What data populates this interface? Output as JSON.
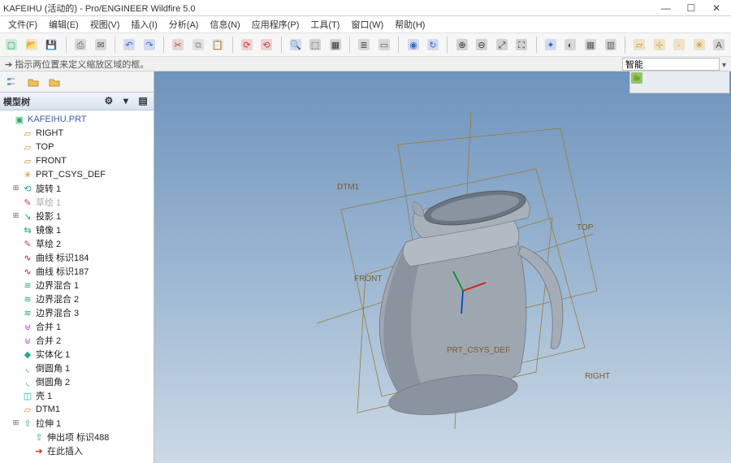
{
  "title": "KAFEIHU (活动的) - Pro/ENGINEER Wildfire 5.0",
  "menu": [
    "文件(F)",
    "编辑(E)",
    "视图(V)",
    "插入(I)",
    "分析(A)",
    "信息(N)",
    "应用程序(P)",
    "工具(T)",
    "窗口(W)",
    "帮助(H)"
  ],
  "statusMessage": "➔ 指示两位置来定义缩放区域的框。",
  "smartLabel": "智能",
  "treeHeader": "模型树",
  "tree": [
    {
      "lvl": 0,
      "exp": "",
      "icon": "part",
      "label": "KAFEIHU.PRT",
      "color": "#3a5ea8"
    },
    {
      "lvl": 1,
      "exp": "",
      "icon": "plane",
      "label": "RIGHT"
    },
    {
      "lvl": 1,
      "exp": "",
      "icon": "plane",
      "label": "TOP"
    },
    {
      "lvl": 1,
      "exp": "",
      "icon": "plane",
      "label": "FRONT"
    },
    {
      "lvl": 1,
      "exp": "",
      "icon": "csys",
      "label": "PRT_CSYS_DEF"
    },
    {
      "lvl": 1,
      "exp": "+",
      "icon": "revolve",
      "label": "旋转 1"
    },
    {
      "lvl": 1,
      "exp": "",
      "icon": "sketch",
      "label": "草绘 1",
      "dim": true
    },
    {
      "lvl": 1,
      "exp": "+",
      "icon": "project",
      "label": "投影 1"
    },
    {
      "lvl": 1,
      "exp": "",
      "icon": "mirror",
      "label": "镜像 1"
    },
    {
      "lvl": 1,
      "exp": "",
      "icon": "sketch",
      "label": "草绘 2"
    },
    {
      "lvl": 1,
      "exp": "",
      "icon": "curve",
      "label": "曲线 标识184"
    },
    {
      "lvl": 1,
      "exp": "",
      "icon": "curve",
      "label": "曲线 标识187"
    },
    {
      "lvl": 1,
      "exp": "",
      "icon": "blend",
      "label": "边界混合 1"
    },
    {
      "lvl": 1,
      "exp": "",
      "icon": "blend",
      "label": "边界混合 2"
    },
    {
      "lvl": 1,
      "exp": "",
      "icon": "blend",
      "label": "边界混合 3"
    },
    {
      "lvl": 1,
      "exp": "",
      "icon": "merge",
      "label": "合并 1"
    },
    {
      "lvl": 1,
      "exp": "",
      "icon": "merge",
      "label": "合并 2"
    },
    {
      "lvl": 1,
      "exp": "",
      "icon": "solidify",
      "label": "实体化 1"
    },
    {
      "lvl": 1,
      "exp": "",
      "icon": "round",
      "label": "倒圆角 1"
    },
    {
      "lvl": 1,
      "exp": "",
      "icon": "round",
      "label": "倒圆角 2"
    },
    {
      "lvl": 1,
      "exp": "",
      "icon": "shell",
      "label": "壳 1"
    },
    {
      "lvl": 1,
      "exp": "",
      "icon": "plane",
      "label": "DTM1"
    },
    {
      "lvl": 1,
      "exp": "+",
      "icon": "extrude",
      "label": "拉伸 1"
    },
    {
      "lvl": 2,
      "exp": "",
      "icon": "extrude",
      "label": "伸出项 标识488"
    },
    {
      "lvl": 2,
      "exp": "",
      "icon": "insert",
      "label": "在此插入"
    }
  ],
  "viewportLabels": {
    "dtm1": "DTM1",
    "top": "TOP",
    "front": "FRONT",
    "right": "RIGHT",
    "csys": "PRT_CSYS_DEF"
  },
  "icons": {
    "new": "#2a6",
    "open": "#c90",
    "save": "#36c",
    "print": "#555",
    "undo": "#36c",
    "redo": "#36c",
    "cut": "#a44",
    "copy": "#888",
    "paste": "#8a4",
    "regen": "#c33",
    "find": "#36c",
    "select": "#333",
    "zoomwin": "#333",
    "zoomfit": "#333",
    "zoomall": "#333",
    "refit": "#333",
    "spin": "#36c",
    "planes": "#c80",
    "axes": "#c80",
    "points": "#c80",
    "csys": "#c80",
    "annot": "#555",
    "r1": "#6a2",
    "r2": "#6a2",
    "r3": "#6a2",
    "r4": "#6a2",
    "r5": "#6a2"
  }
}
